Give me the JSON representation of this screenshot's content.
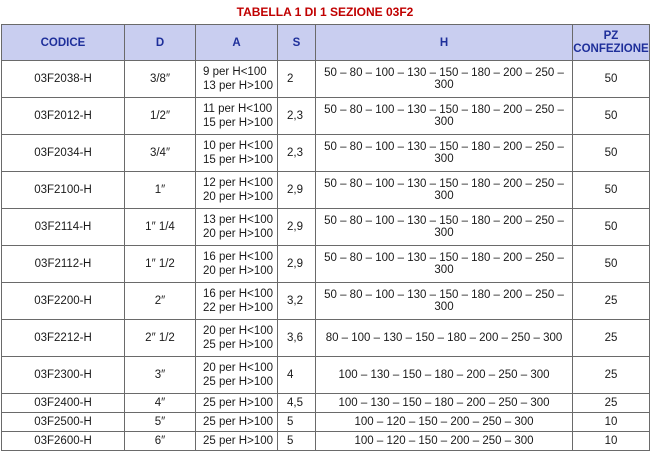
{
  "title": "TABELLA 1 DI 1 SEZIONE 03F2",
  "headers": {
    "codice": "CODICE",
    "d": "D",
    "a": "A",
    "s": "S",
    "h": "H",
    "pz_line1": "PZ",
    "pz_line2": "CONFEZIONE"
  },
  "rows": [
    {
      "codice": "03F2038-H",
      "d": "3/8″",
      "a1": "9 per H<100",
      "a2": "13 per H>100",
      "s": "2",
      "h": "50 – 80 – 100 – 130 – 150 – 180 – 200 – 250 – 300",
      "pz": "50"
    },
    {
      "codice": "03F2012-H",
      "d": "1/2″",
      "a1": "11 per H<100",
      "a2": "15 per H>100",
      "s": "2,3",
      "h": "50 – 80 – 100 – 130 – 150 – 180 – 200 – 250 – 300",
      "pz": "50"
    },
    {
      "codice": "03F2034-H",
      "d": "3/4″",
      "a1": "10 per H<100",
      "a2": "15 per H>100",
      "s": "2,3",
      "h": "50 – 80 – 100 – 130 – 150 – 180 – 200 – 250 – 300",
      "pz": "50"
    },
    {
      "codice": "03F2100-H",
      "d": "1″",
      "a1": "12 per H<100",
      "a2": "20 per H>100",
      "s": "2,9",
      "h": "50 – 80 – 100 – 130 – 150 – 180 – 200 – 250 – 300",
      "pz": "50"
    },
    {
      "codice": "03F2114-H",
      "d": "1″ 1/4",
      "a1": "13 per H<100",
      "a2": "20 per H>100",
      "s": "2,9",
      "h": "50 – 80 – 100 – 130 – 150 – 180 – 200 – 250 – 300",
      "pz": "50"
    },
    {
      "codice": "03F2112-H",
      "d": "1″ 1/2",
      "a1": "16 per H<100",
      "a2": "20 per H>100",
      "s": "2,9",
      "h": "50 – 80 – 100 – 130 – 150 – 180 – 200 – 250 – 300",
      "pz": "50"
    },
    {
      "codice": "03F2200-H",
      "d": "2″",
      "a1": "16 per H<100",
      "a2": "22 per H>100",
      "s": "3,2",
      "h": "50 – 80 – 100 – 130 – 150 – 180 – 200 – 250 – 300",
      "pz": "25"
    },
    {
      "codice": "03F2212-H",
      "d": "2″ 1/2",
      "a1": "20 per H<100",
      "a2": "25 per H>100",
      "s": "3,6",
      "h": "80 – 100 – 130 – 150 – 180 – 200 – 250 – 300",
      "pz": "25"
    },
    {
      "codice": "03F2300-H",
      "d": "3″",
      "a1": "20 per H<100",
      "a2": "25 per H>100",
      "s": "4",
      "h": "100 – 130 – 150 – 180 – 200 – 250 – 300",
      "pz": "25"
    },
    {
      "codice": "03F2400-H",
      "d": "4″",
      "a1": "25 per H>100",
      "a2": "",
      "s": "4,5",
      "h": "100 – 130 – 150 – 180 – 200 – 250 – 300",
      "pz": "25"
    },
    {
      "codice": "03F2500-H",
      "d": "5″",
      "a1": "25 per H>100",
      "a2": "",
      "s": "5",
      "h": "100 – 120 – 150 – 200 – 250 – 300",
      "pz": "10"
    },
    {
      "codice": "03F2600-H",
      "d": "6″",
      "a1": "25 per H>100",
      "a2": "",
      "s": "5",
      "h": "100 – 120 – 150 – 200 – 250 – 300",
      "pz": "10"
    }
  ]
}
